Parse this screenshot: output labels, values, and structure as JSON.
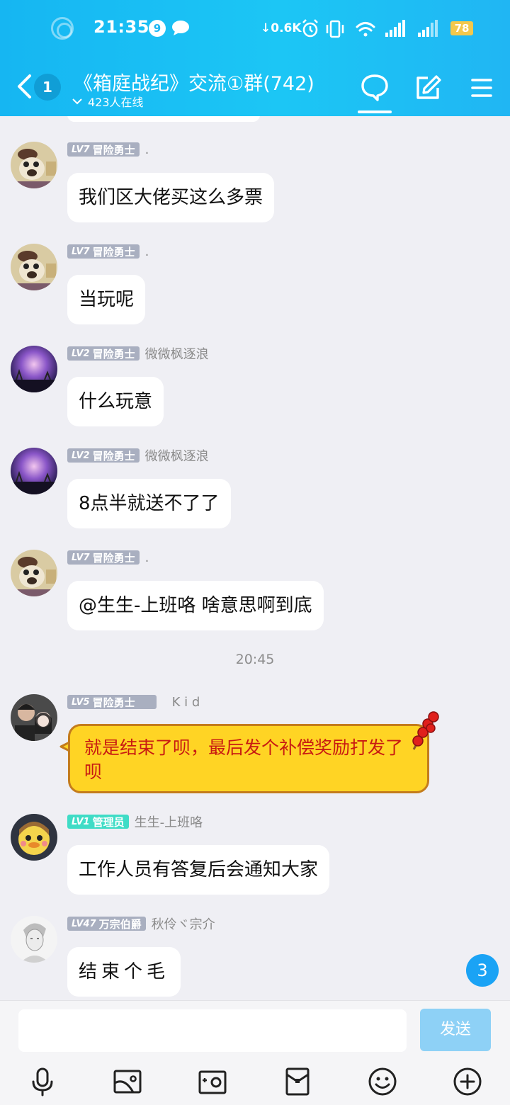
{
  "status_bar": {
    "time": "21:35",
    "notif_count": "9",
    "net_speed": "↓0.6K",
    "battery": "78"
  },
  "header": {
    "back_count": "1",
    "title": "《箱庭战纪》交流①群(742)",
    "online": "423人在线"
  },
  "messages": [
    {
      "level": "LV7",
      "title": "冒险勇士",
      "nick": ".",
      "text": "我们区大佬买这么多票"
    },
    {
      "level": "LV7",
      "title": "冒险勇士",
      "nick": ".",
      "text": "当玩呢"
    },
    {
      "level": "LV2",
      "title": "冒险勇士",
      "nick": "微微枫逐浪",
      "text": "什么玩意"
    },
    {
      "level": "LV2",
      "title": "冒险勇士",
      "nick": "微微枫逐浪",
      "text": "8点半就送不了了"
    },
    {
      "level": "LV7",
      "title": "冒险勇士",
      "nick": ".",
      "text": "@生生-上班咯 啥意思啊到底"
    },
    {
      "level": "LV5",
      "title": "冒险勇士",
      "nick": "K i d",
      "text": "就是结束了呗，最后发个补偿奖励打发了呗"
    },
    {
      "level": "LV1",
      "title": "管理员",
      "nick": "生生-上班咯",
      "text": "工作人员有答复后会通知大家"
    },
    {
      "level": "LV47",
      "title": "万宗伯爵",
      "nick": "秋伶ヾ宗介",
      "text": "结束个毛"
    }
  ],
  "time_separator": "20:45",
  "unread_badge": "3",
  "input": {
    "value": "",
    "send_label": "发送"
  },
  "toolbar": {
    "icons": [
      "microphone-icon",
      "image-icon",
      "camera-icon",
      "red-packet-icon",
      "emoji-icon",
      "plus-icon"
    ]
  }
}
